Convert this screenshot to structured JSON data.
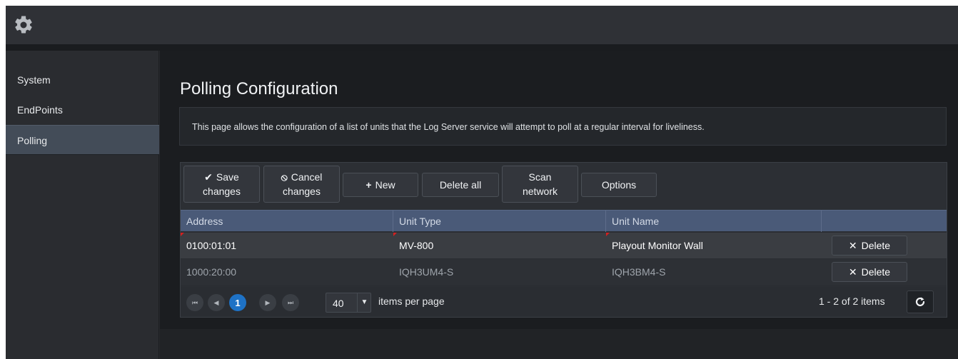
{
  "app": {
    "settings_icon": "gear-icon"
  },
  "sidebar": {
    "items": [
      {
        "label": "System",
        "active": false
      },
      {
        "label": "EndPoints",
        "active": false
      },
      {
        "label": "Polling",
        "active": true
      }
    ]
  },
  "page": {
    "title": "Polling Configuration",
    "description": "This page allows the configuration of a list of units that the Log Server service will attempt to poll at a regular interval for liveliness."
  },
  "toolbar": {
    "save": {
      "icon": "checkmark-icon",
      "line1": "Save",
      "line2": "changes"
    },
    "cancel": {
      "icon": "cancel-icon",
      "line1": "Cancel",
      "line2": "changes"
    },
    "new": {
      "icon": "plus-icon",
      "label": "New"
    },
    "delete_all": {
      "label": "Delete all"
    },
    "scan": {
      "line1": "Scan",
      "line2": "network"
    },
    "options": {
      "label": "Options"
    }
  },
  "table": {
    "columns": [
      "Address",
      "Unit Type",
      "Unit Name",
      ""
    ],
    "rows": [
      {
        "address": "0100:01:01",
        "unit_type": "MV-800",
        "unit_name": "Playout Monitor Wall",
        "action": "Delete",
        "modified": true
      },
      {
        "address": "1000:20:00",
        "unit_type": "IQH3UM4-S",
        "unit_name": "IQH3BM4-S",
        "action": "Delete",
        "modified": false
      }
    ]
  },
  "pager": {
    "current_page": "1",
    "page_size": "40",
    "page_size_label": "items per page",
    "info": "1 - 2 of 2 items"
  },
  "colors": {
    "header_bg": "#4a5a78",
    "active_page": "#1e72c6",
    "dirty_marker": "#d42020"
  }
}
